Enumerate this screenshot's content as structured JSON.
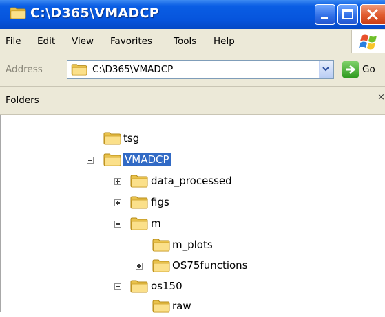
{
  "window": {
    "title": "C:\\D365\\VMADCP"
  },
  "menu": {
    "items": [
      "File",
      "Edit",
      "View",
      "Favorites",
      "Tools",
      "Help"
    ]
  },
  "address": {
    "label": "Address",
    "value": "C:\\D365\\VMADCP",
    "go_label": "Go"
  },
  "folders_pane": {
    "title": "Folders",
    "close_label": "×",
    "tree": [
      {
        "label": "tsg"
      },
      {
        "label": "VMADCP",
        "selected": true,
        "expanded": true
      },
      {
        "label": "data_processed",
        "expanded": false
      },
      {
        "label": "figs",
        "expanded": false
      },
      {
        "label": "m",
        "expanded": true
      },
      {
        "label": "m_plots"
      },
      {
        "label": "OS75functions",
        "expanded": false
      },
      {
        "label": "os150",
        "expanded": true
      },
      {
        "label": "raw"
      }
    ]
  },
  "colors": {
    "titlebar": "#0654dc",
    "selection": "#316ac5",
    "chrome": "#ece9d8",
    "folder": "#f6d56a"
  }
}
